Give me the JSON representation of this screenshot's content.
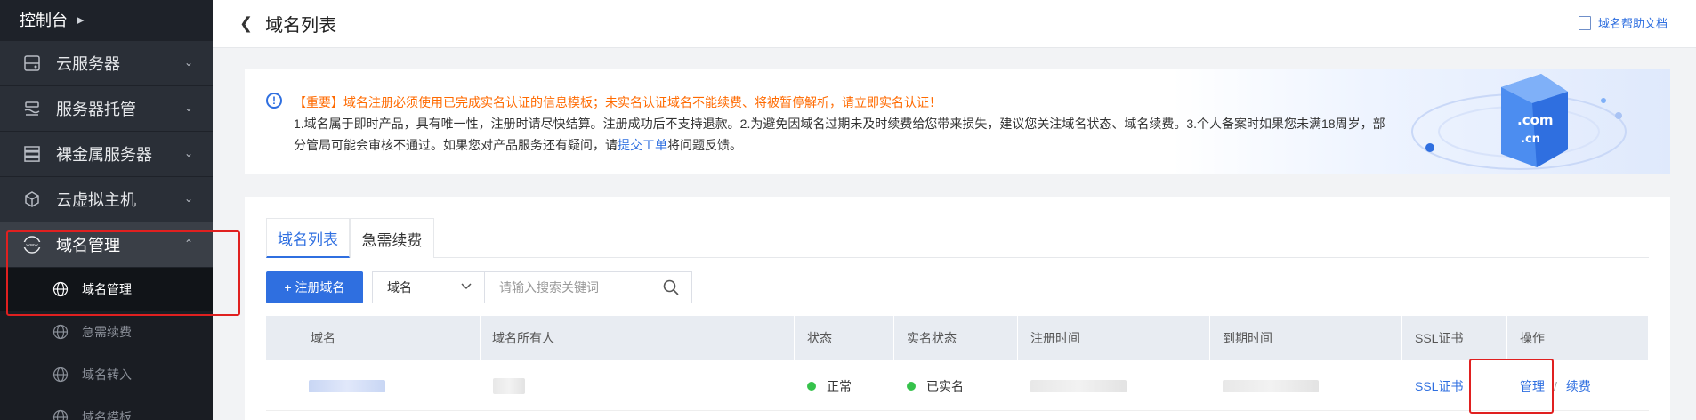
{
  "sidebar": {
    "console_label": "控制台",
    "items": [
      {
        "label": "云服务器",
        "icon": "server-icon"
      },
      {
        "label": "服务器托管",
        "icon": "hosting-icon"
      },
      {
        "label": "裸金属服务器",
        "icon": "bare-metal-icon"
      },
      {
        "label": "云虚拟主机",
        "icon": "cube-icon"
      },
      {
        "label": "域名管理",
        "icon": "www-icon"
      }
    ],
    "sub_items": [
      {
        "label": "域名管理",
        "icon": "globe-icon"
      },
      {
        "label": "急需续费",
        "icon": "globe-icon"
      },
      {
        "label": "域名转入",
        "icon": "globe-icon"
      },
      {
        "label": "域名模板",
        "icon": "globe-icon"
      }
    ]
  },
  "header": {
    "title": "域名列表",
    "help_label": "域名帮助文档"
  },
  "notice": {
    "line1": "【重要】域名注册必须使用已完成实名认证的信息模板；未实名认证域名不能续费、将被暂停解析，请立即实名认证！",
    "line2": "1.域名属于即时产品，具有唯一性，注册时请尽快结算。注册成功后不支持退款。2.为避免因域名过期未及时续费给您带来损失，建议您关注域名状态、域名续费。3.个人备案时如果您未满18周岁，部",
    "line3_before": "分管局可能会审核不通过。如果您对产品服务还有疑问，请",
    "line3_link": "提交工单",
    "line3_after": "将问题反馈。",
    "illustration_text_1": ".com",
    "illustration_text_2": ".cn"
  },
  "tabs": [
    {
      "label": "域名列表",
      "active": true
    },
    {
      "label": "急需续费",
      "active": false
    }
  ],
  "toolbar": {
    "register_label": "+ 注册域名",
    "select_value": "域名",
    "search_placeholder": "请输入搜索关键词"
  },
  "table": {
    "columns": [
      "域名",
      "域名所有人",
      "状态",
      "实名状态",
      "注册时间",
      "到期时间",
      "SSL证书",
      "操作"
    ],
    "rows": [
      {
        "status": "正常",
        "realname_status": "已实名",
        "ssl": "SSL证书",
        "action_manage": "管理",
        "action_separator": "/",
        "action_renew": "续费"
      }
    ]
  },
  "colors": {
    "accent": "#2f6fe0",
    "warning": "#ff6a00",
    "status_ok": "#35c24b",
    "highlight_box": "#e02020",
    "sidebar_bg": "#1e2229"
  }
}
